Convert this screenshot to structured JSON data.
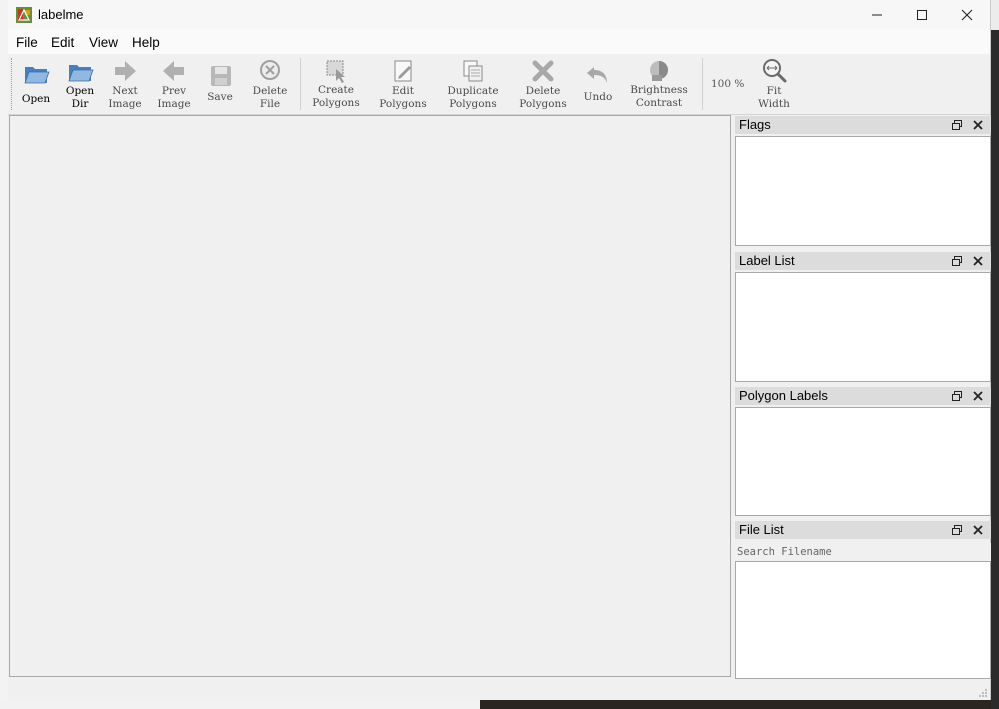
{
  "window": {
    "title": "labelme"
  },
  "menu": {
    "file": "File",
    "edit": "Edit",
    "view": "View",
    "help": "Help"
  },
  "toolbar": {
    "open": "Open",
    "open_dir": "Open\nDir",
    "next_image": "Next\nImage",
    "prev_image": "Prev\nImage",
    "save": "Save",
    "delete_file": "Delete\nFile",
    "create_polygons": "Create\nPolygons",
    "edit_polygons": "Edit\nPolygons",
    "duplicate_polygons": "Duplicate\nPolygons",
    "delete_polygons": "Delete\nPolygons",
    "undo": "Undo",
    "brightness_contrast": "Brightness\nContrast",
    "zoom_level": "100 %",
    "fit_width": "Fit\nWidth"
  },
  "docks": {
    "flags": "Flags",
    "label_list": "Label List",
    "polygon_labels": "Polygon Labels",
    "file_list": "File List",
    "search_placeholder": "Search Filename"
  },
  "colors": {
    "toolbar_bg": "#f0f0f0",
    "dock_title_bg": "#dcdcdc",
    "icon_blue": "#5b8fc9"
  }
}
